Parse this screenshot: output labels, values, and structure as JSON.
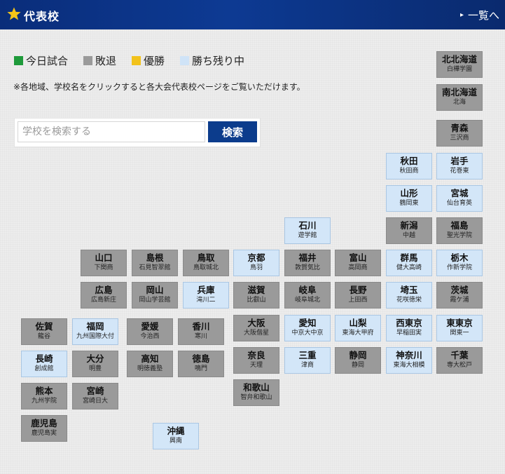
{
  "header": {
    "title": "代表校",
    "more_label": "一覧へ"
  },
  "legend": [
    {
      "label": "今日試合",
      "color": "#1e9a3a"
    },
    {
      "label": "敗退",
      "color": "#9a9a9a"
    },
    {
      "label": "優勝",
      "color": "#f2c21b"
    },
    {
      "label": "勝ち残り中",
      "color": "#cfe3f7"
    }
  ],
  "note": "※各地域、学校名をクリックすると各大会代表校ページをご覧いただけます。",
  "search": {
    "placeholder": "学校を検索する",
    "button_label": "検索"
  },
  "prefectures": [
    {
      "id": "kitahokkaido",
      "name": "北北海道",
      "school": "白樺学園",
      "status": "lost"
    },
    {
      "id": "minamihokkaido",
      "name": "南北海道",
      "school": "北海",
      "status": "lost"
    },
    {
      "id": "aomori",
      "name": "青森",
      "school": "三沢商",
      "status": "lost"
    },
    {
      "id": "akita",
      "name": "秋田",
      "school": "秋田商",
      "status": "alive"
    },
    {
      "id": "iwate",
      "name": "岩手",
      "school": "花巻東",
      "status": "alive"
    },
    {
      "id": "yamagata",
      "name": "山形",
      "school": "鶴岡東",
      "status": "alive"
    },
    {
      "id": "miyagi",
      "name": "宮城",
      "school": "仙台育英",
      "status": "alive"
    },
    {
      "id": "ishikawa",
      "name": "石川",
      "school": "遊学館",
      "status": "alive"
    },
    {
      "id": "niigata",
      "name": "新潟",
      "school": "中越",
      "status": "lost"
    },
    {
      "id": "fukushima",
      "name": "福島",
      "school": "聖光学院",
      "status": "lost"
    },
    {
      "id": "yamaguchi",
      "name": "山口",
      "school": "下関商",
      "status": "lost"
    },
    {
      "id": "shimane",
      "name": "島根",
      "school": "石見智翠館",
      "status": "lost"
    },
    {
      "id": "tottori",
      "name": "鳥取",
      "school": "鳥取城北",
      "status": "lost"
    },
    {
      "id": "kyoto",
      "name": "京都",
      "school": "鳥羽",
      "status": "alive"
    },
    {
      "id": "fukui",
      "name": "福井",
      "school": "敦賀気比",
      "status": "lost"
    },
    {
      "id": "toyama",
      "name": "富山",
      "school": "高岡商",
      "status": "lost"
    },
    {
      "id": "gunma",
      "name": "群馬",
      "school": "健大高崎",
      "status": "alive"
    },
    {
      "id": "tochigi",
      "name": "栃木",
      "school": "作新学院",
      "status": "alive"
    },
    {
      "id": "hiroshima",
      "name": "広島",
      "school": "広島新庄",
      "status": "lost"
    },
    {
      "id": "okayama",
      "name": "岡山",
      "school": "岡山学芸館",
      "status": "lost"
    },
    {
      "id": "hyogo",
      "name": "兵庫",
      "school": "滝川二",
      "status": "alive"
    },
    {
      "id": "shiga",
      "name": "滋賀",
      "school": "比叡山",
      "status": "lost"
    },
    {
      "id": "gifu",
      "name": "岐阜",
      "school": "岐阜城北",
      "status": "lost"
    },
    {
      "id": "nagano",
      "name": "長野",
      "school": "上田西",
      "status": "lost"
    },
    {
      "id": "saitama",
      "name": "埼玉",
      "school": "花咲徳栄",
      "status": "alive"
    },
    {
      "id": "ibaraki",
      "name": "茨城",
      "school": "霞ケ浦",
      "status": "lost"
    },
    {
      "id": "saga",
      "name": "佐賀",
      "school": "龍谷",
      "status": "lost"
    },
    {
      "id": "fukuoka",
      "name": "福岡",
      "school": "九州国際大付",
      "status": "alive"
    },
    {
      "id": "ehime",
      "name": "愛媛",
      "school": "今治西",
      "status": "lost"
    },
    {
      "id": "kagawa",
      "name": "香川",
      "school": "寒川",
      "status": "lost"
    },
    {
      "id": "osaka",
      "name": "大阪",
      "school": "大阪偕星",
      "status": "lost"
    },
    {
      "id": "aichi",
      "name": "愛知",
      "school": "中京大中京",
      "status": "alive"
    },
    {
      "id": "yamanashi",
      "name": "山梨",
      "school": "東海大甲府",
      "status": "alive"
    },
    {
      "id": "nishitokyo",
      "name": "西東京",
      "school": "早稲田実",
      "status": "alive"
    },
    {
      "id": "higashitokyo",
      "name": "東東京",
      "school": "関東一",
      "status": "alive"
    },
    {
      "id": "nagasaki",
      "name": "長崎",
      "school": "創成館",
      "status": "alive"
    },
    {
      "id": "oita",
      "name": "大分",
      "school": "明豊",
      "status": "lost"
    },
    {
      "id": "kochi",
      "name": "高知",
      "school": "明徳義塾",
      "status": "lost"
    },
    {
      "id": "tokushima",
      "name": "徳島",
      "school": "鳴門",
      "status": "lost"
    },
    {
      "id": "nara",
      "name": "奈良",
      "school": "天理",
      "status": "lost"
    },
    {
      "id": "mie",
      "name": "三重",
      "school": "津商",
      "status": "alive"
    },
    {
      "id": "shizuoka",
      "name": "静岡",
      "school": "静岡",
      "status": "lost"
    },
    {
      "id": "kanagawa",
      "name": "神奈川",
      "school": "東海大相模",
      "status": "alive"
    },
    {
      "id": "chiba",
      "name": "千葉",
      "school": "専大松戸",
      "status": "lost"
    },
    {
      "id": "kumamoto",
      "name": "熊本",
      "school": "九州学院",
      "status": "lost"
    },
    {
      "id": "miyazaki",
      "name": "宮崎",
      "school": "宮崎日大",
      "status": "lost"
    },
    {
      "id": "wakayama",
      "name": "和歌山",
      "school": "智弁和歌山",
      "status": "lost"
    },
    {
      "id": "kagoshima",
      "name": "鹿児島",
      "school": "鹿児島実",
      "status": "lost"
    },
    {
      "id": "okinawa",
      "name": "沖縄",
      "school": "興南",
      "status": "alive"
    }
  ]
}
